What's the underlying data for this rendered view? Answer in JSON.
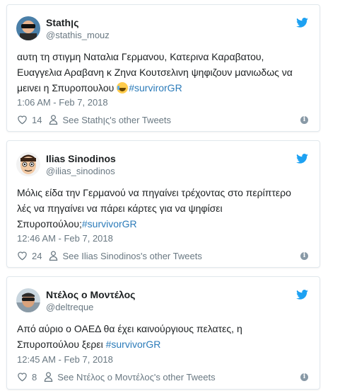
{
  "tweets": [
    {
      "name": "Stathןς",
      "handle": "@stathis_mouz",
      "text": "αυτη τη στιγμη Ναταλια Γερμανου, Κατερινα Καραβατου, Ευαγγελια Αραβανη κ Ζηνα Κουτσελινη ψηφιζουν μανιωδως να μεινει η Σπυροπουλου ",
      "hashtag": "#survirorGR",
      "time": "1:06 AM - Feb 7, 2018",
      "likes": "14",
      "other_link": "See Stathןς's other Tweets",
      "avatar": "avatar-sunglasses"
    },
    {
      "name": "Ilias Sinodinos",
      "handle": "@ilias_sinodinos",
      "text": "Μόλις είδα την Γερμανού να πηγαίνει τρέχοντας στο περίπτερο λές να πηγαίνει να πάρει κάρτες για να ψηφίσει Σπυροπούλου;",
      "hashtag": "#survivorGR",
      "time": "12:46 AM - Feb 7, 2018",
      "likes": "24",
      "other_link": "See Ilias Sinodinos's other Tweets",
      "avatar": "avatar-cartoon-face"
    },
    {
      "name": "Ντέλος ο Μοντέλος",
      "handle": "@deltreque",
      "text": "Από αύριο ο ΟΑΕΔ θα έχει καινούργιους πελατες, η Σπυροπούλου ξερει ",
      "hashtag": "#survivorGR",
      "time": "12:45 AM - Feb 7, 2018",
      "likes": "8",
      "other_link": "See Ντέλος ο Μοντέλος's other Tweets",
      "avatar": "avatar-photo"
    }
  ],
  "colors": {
    "twitter_blue": "#1da1f2",
    "hashtag": "#2b7bb9",
    "meta_gray": "#697882",
    "border": "#e1e8ed"
  }
}
